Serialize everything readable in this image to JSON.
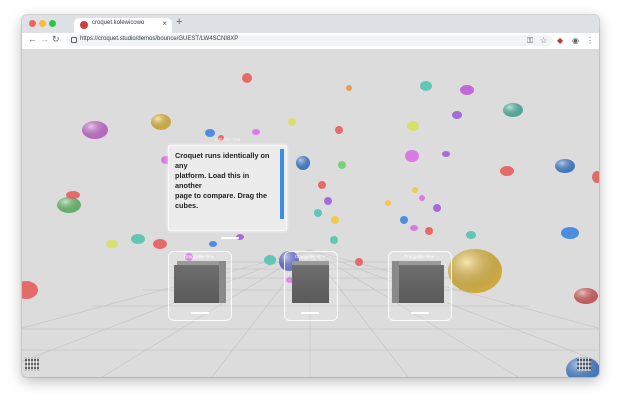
{
  "browser": {
    "tab_title": "croquet.kolewicowo",
    "new_tab": "+",
    "tab_close": "×",
    "url": "https://croquet.studio/demos/bounce/GUEST/LW4SCNI8XP",
    "nav": {
      "back": "←",
      "forward": "→",
      "reload": "↻"
    },
    "toolbar_icons": [
      "key-icon",
      "star-icon",
      "extension-icon",
      "profile-icon",
      "menu-icon"
    ]
  },
  "scene": {
    "editor": {
      "label": "Editable Text",
      "text": "Croquet runs identically on any\n platform. Load this in another\npage to compare. Drag the\ncubes."
    },
    "cubes": [
      {
        "label": "Draggable Box"
      },
      {
        "label": "Draggable Box"
      },
      {
        "label": "Draggable Box"
      }
    ]
  },
  "colors": {
    "background": "#dcdcdc",
    "chrome_bar": "#dee1e6",
    "accent": "#3d8fe6"
  }
}
